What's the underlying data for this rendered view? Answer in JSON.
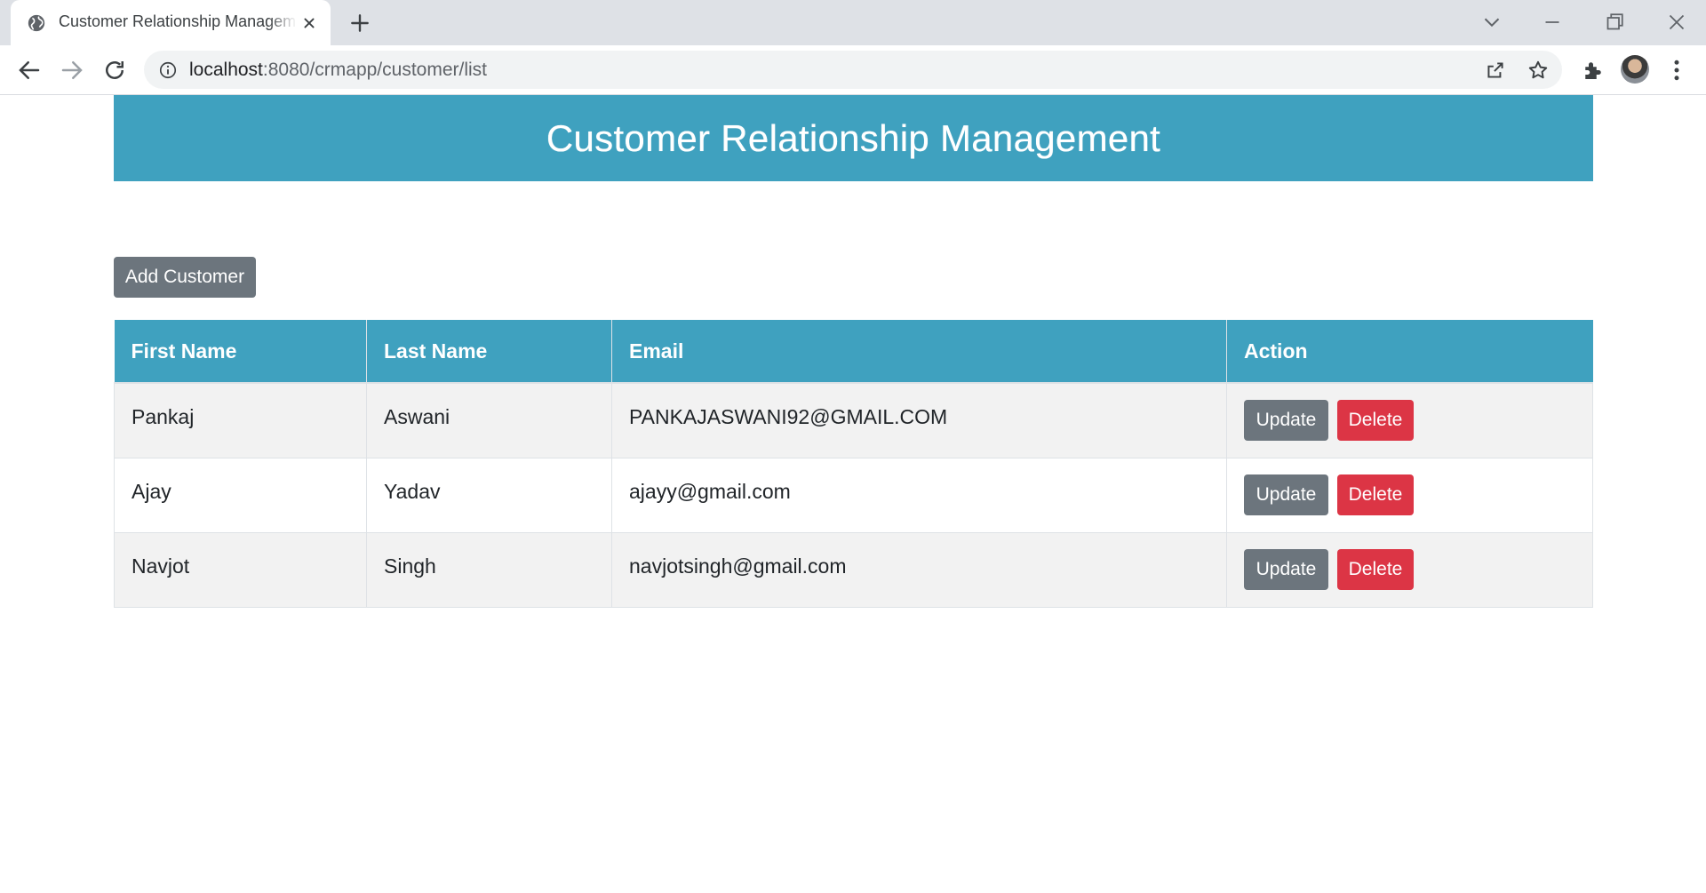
{
  "browser": {
    "tab_title": "Customer Relationship Management",
    "url_host": "localhost",
    "url_path": ":8080/crmapp/customer/list"
  },
  "page": {
    "title": "Customer Relationship Management",
    "add_button_label": "Add Customer",
    "update_label": "Update",
    "delete_label": "Delete",
    "colors": {
      "header_bg": "#3fa1bf",
      "secondary_button": "#6c757d",
      "danger_button": "#dc3545"
    }
  },
  "table": {
    "headers": [
      "First Name",
      "Last Name",
      "Email",
      "Action"
    ],
    "rows": [
      {
        "first_name": "Pankaj",
        "last_name": "Aswani",
        "email": "PANKAJASWANI92@GMAIL.COM"
      },
      {
        "first_name": "Ajay",
        "last_name": "Yadav",
        "email": "ajayy@gmail.com"
      },
      {
        "first_name": "Navjot",
        "last_name": "Singh",
        "email": "navjotsingh@gmail.com"
      }
    ]
  }
}
